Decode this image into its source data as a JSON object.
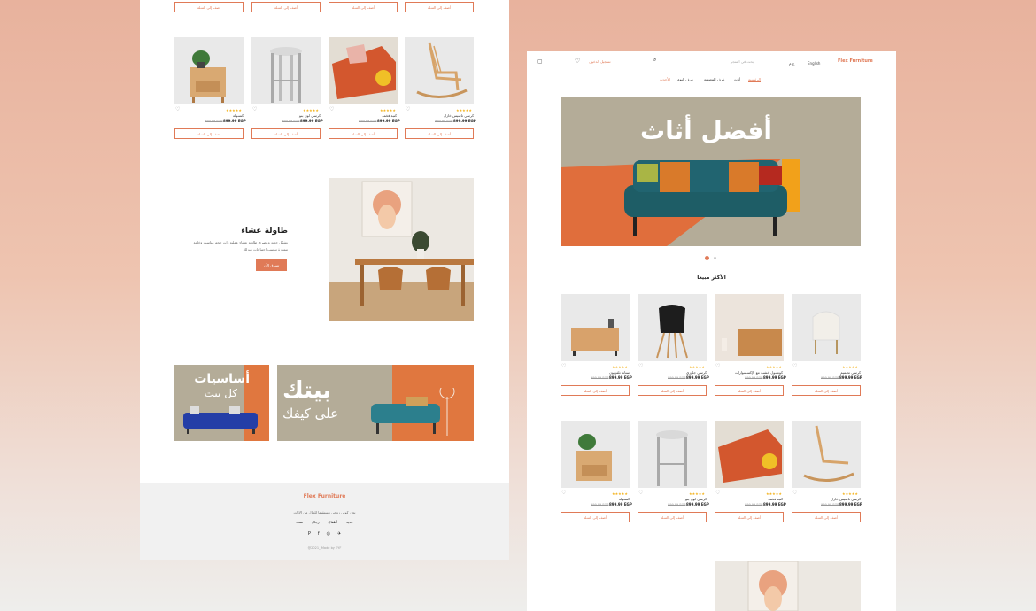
{
  "colors": {
    "accent": "#e07a57",
    "star": "#f3b21b",
    "hero_bg": "#b4ac98",
    "hero_sofa": "#1e5d66"
  },
  "common": {
    "add_to_cart": "أضف إلى السلة",
    "currency_price": "899.99 EGP",
    "old_price": "999.99 EGP",
    "rating": "★★★★★"
  },
  "left": {
    "product_row": [
      {
        "name": "كرسي تاسيس خازل"
      },
      {
        "name": "كنبة فخمة"
      },
      {
        "name": "كرسي لون بنو"
      },
      {
        "name": "كنسولة"
      }
    ],
    "feature": {
      "title": "طاولة عشاء",
      "description_1": "بشكل جديد وعصري طاولة عشاء عملية ذات حجم مناسب وخامة",
      "description_2": "ممتازة تناسب احتياجات منزلك",
      "button": "تسوق الآن"
    },
    "banner_left": {
      "line1": "أساسيات",
      "line2": "كل بيت"
    },
    "banner_right": {
      "line1": "بيتك",
      "line2": "على كيفك"
    },
    "footer": {
      "logo": "Flex Furniture",
      "tagline": "نحن كوني زوجي مستقيما للحال من الاثاث",
      "links": [
        "نساء",
        "رجال",
        "أطفال",
        "جديد"
      ],
      "social": [
        "twitter-icon",
        "instagram-icon",
        "facebook-icon",
        "pinterest-icon"
      ],
      "copyright": "@2021_ Made by EYF"
    }
  },
  "right": {
    "header": {
      "logo": "Flex Furniture",
      "language": "English",
      "currency": "ج.م",
      "search_placeholder": "بحث في المتجر",
      "login": "تسجيل الدخول"
    },
    "nav": [
      "الرئيسية",
      "أثاث",
      "غرف المعيشة",
      "غرف النوم",
      "الأحدث"
    ],
    "hero": {
      "title": "أفضل أثاث"
    },
    "best_sellers_title": "الأكثر مبيعا",
    "products_row1": [
      {
        "name": "كرسي تصميم"
      },
      {
        "name": "كونسول خشب مع الإكسسوارات"
      },
      {
        "name": "كرسي جلوزي"
      },
      {
        "name": "ستاند تلفزيون"
      }
    ],
    "products_row2": [
      {
        "name": "كرسي تاسيس خازل"
      },
      {
        "name": "كنبة فخمة"
      },
      {
        "name": "كرسي لون بنو"
      },
      {
        "name": "كنسولة"
      }
    ]
  }
}
